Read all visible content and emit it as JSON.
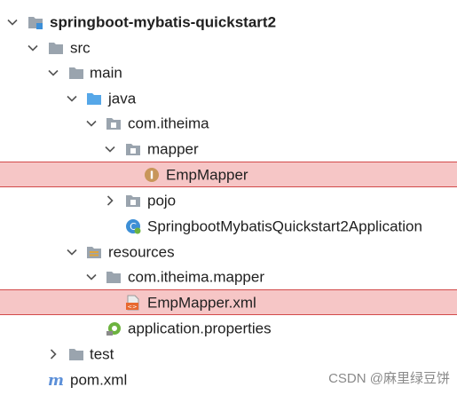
{
  "tree": {
    "root": "springboot-mybatis-quickstart2",
    "src": "src",
    "main": "main",
    "java": "java",
    "package": "com.itheima",
    "mapper": "mapper",
    "emp_mapper": "EmpMapper",
    "pojo": "pojo",
    "application_class": "SpringbootMybatisQuickstart2Application",
    "resources": "resources",
    "resources_package": "com.itheima.mapper",
    "emp_mapper_xml": "EmpMapper.xml",
    "application_properties": "application.properties",
    "test": "test",
    "pom": "pom.xml"
  },
  "highlight_color": "#f6c6c6",
  "watermark": "CSDN @麻里绿豆饼"
}
